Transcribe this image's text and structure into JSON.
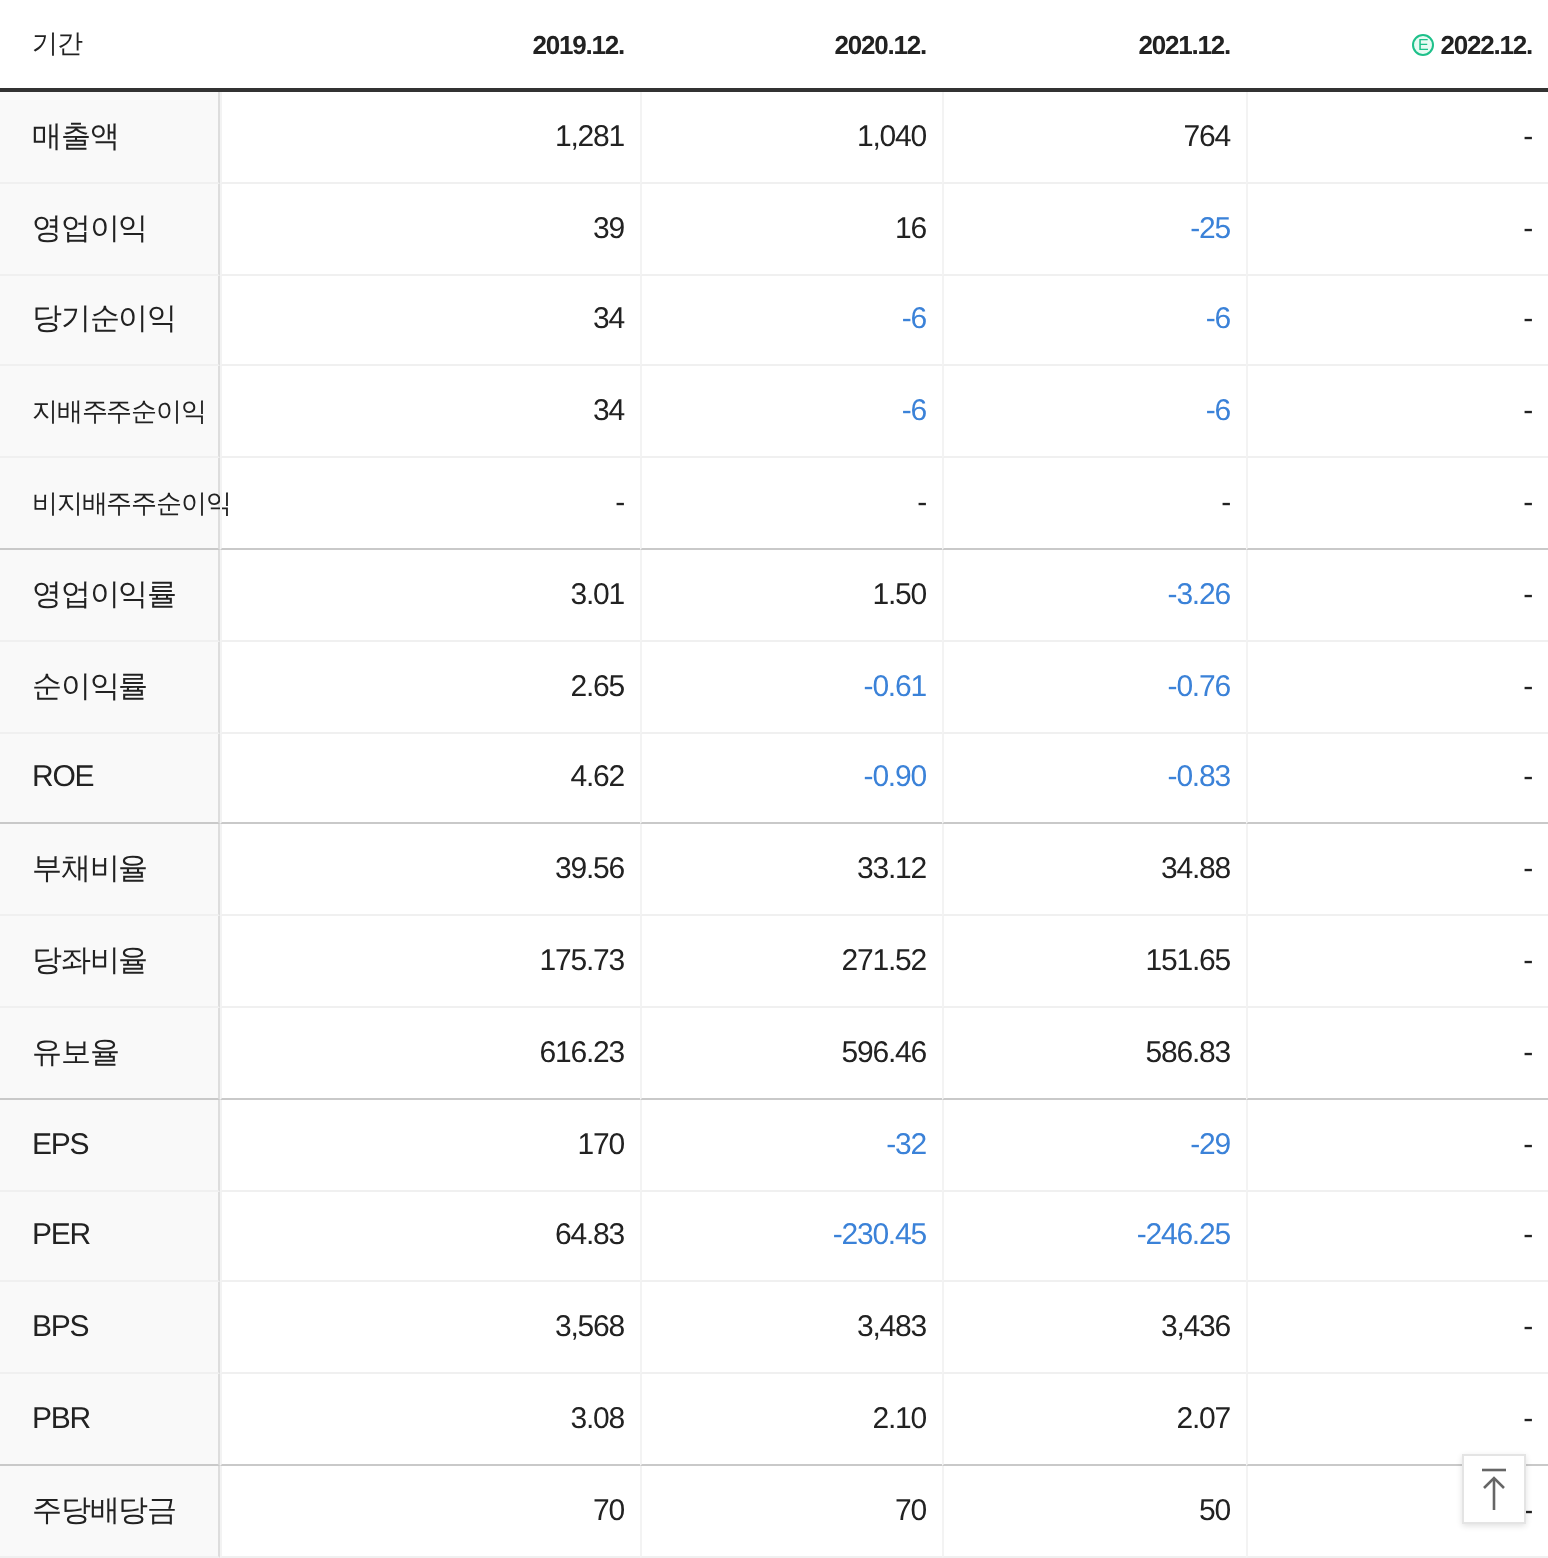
{
  "table": {
    "label_header": "기간",
    "columns": [
      {
        "label": "2019.12.",
        "estimate": false
      },
      {
        "label": "2020.12.",
        "estimate": false
      },
      {
        "label": "2021.12.",
        "estimate": false
      },
      {
        "label": "2022.12.",
        "estimate": true,
        "badge": "E"
      }
    ],
    "rows": [
      {
        "label": "매출액",
        "kind": "main",
        "section_end": false,
        "cells": [
          {
            "text": "1,281",
            "negative": false
          },
          {
            "text": "1,040",
            "negative": false
          },
          {
            "text": "764",
            "negative": false
          },
          {
            "text": "-",
            "negative": false
          }
        ]
      },
      {
        "label": "영업이익",
        "kind": "main",
        "section_end": false,
        "cells": [
          {
            "text": "39",
            "negative": false
          },
          {
            "text": "16",
            "negative": false
          },
          {
            "text": "-25",
            "negative": true
          },
          {
            "text": "-",
            "negative": false
          }
        ]
      },
      {
        "label": "당기순이익",
        "kind": "main",
        "section_end": false,
        "cells": [
          {
            "text": "34",
            "negative": false
          },
          {
            "text": "-6",
            "negative": true
          },
          {
            "text": "-6",
            "negative": true
          },
          {
            "text": "-",
            "negative": false
          }
        ]
      },
      {
        "label": "지배주주순이익",
        "kind": "sub",
        "section_end": false,
        "cells": [
          {
            "text": "34",
            "negative": false
          },
          {
            "text": "-6",
            "negative": true
          },
          {
            "text": "-6",
            "negative": true
          },
          {
            "text": "-",
            "negative": false
          }
        ]
      },
      {
        "label": "비지배주주순이익",
        "kind": "sub",
        "section_end": true,
        "cells": [
          {
            "text": "-",
            "negative": false
          },
          {
            "text": "-",
            "negative": false
          },
          {
            "text": "-",
            "negative": false
          },
          {
            "text": "-",
            "negative": false
          }
        ]
      },
      {
        "label": "영업이익률",
        "kind": "main",
        "section_end": false,
        "cells": [
          {
            "text": "3.01",
            "negative": false
          },
          {
            "text": "1.50",
            "negative": false
          },
          {
            "text": "-3.26",
            "negative": true
          },
          {
            "text": "-",
            "negative": false
          }
        ]
      },
      {
        "label": "순이익률",
        "kind": "main",
        "section_end": false,
        "cells": [
          {
            "text": "2.65",
            "negative": false
          },
          {
            "text": "-0.61",
            "negative": true
          },
          {
            "text": "-0.76",
            "negative": true
          },
          {
            "text": "-",
            "negative": false
          }
        ]
      },
      {
        "label": "ROE",
        "kind": "main",
        "section_end": true,
        "cells": [
          {
            "text": "4.62",
            "negative": false
          },
          {
            "text": "-0.90",
            "negative": true
          },
          {
            "text": "-0.83",
            "negative": true
          },
          {
            "text": "-",
            "negative": false
          }
        ]
      },
      {
        "label": "부채비율",
        "kind": "main",
        "section_end": false,
        "cells": [
          {
            "text": "39.56",
            "negative": false
          },
          {
            "text": "33.12",
            "negative": false
          },
          {
            "text": "34.88",
            "negative": false
          },
          {
            "text": "-",
            "negative": false
          }
        ]
      },
      {
        "label": "당좌비율",
        "kind": "main",
        "section_end": false,
        "cells": [
          {
            "text": "175.73",
            "negative": false
          },
          {
            "text": "271.52",
            "negative": false
          },
          {
            "text": "151.65",
            "negative": false
          },
          {
            "text": "-",
            "negative": false
          }
        ]
      },
      {
        "label": "유보율",
        "kind": "main",
        "section_end": true,
        "cells": [
          {
            "text": "616.23",
            "negative": false
          },
          {
            "text": "596.46",
            "negative": false
          },
          {
            "text": "586.83",
            "negative": false
          },
          {
            "text": "-",
            "negative": false
          }
        ]
      },
      {
        "label": "EPS",
        "kind": "main",
        "section_end": false,
        "cells": [
          {
            "text": "170",
            "negative": false
          },
          {
            "text": "-32",
            "negative": true
          },
          {
            "text": "-29",
            "negative": true
          },
          {
            "text": "-",
            "negative": false
          }
        ]
      },
      {
        "label": "PER",
        "kind": "main",
        "section_end": false,
        "cells": [
          {
            "text": "64.83",
            "negative": false
          },
          {
            "text": "-230.45",
            "negative": true
          },
          {
            "text": "-246.25",
            "negative": true
          },
          {
            "text": "-",
            "negative": false
          }
        ]
      },
      {
        "label": "BPS",
        "kind": "main",
        "section_end": false,
        "cells": [
          {
            "text": "3,568",
            "negative": false
          },
          {
            "text": "3,483",
            "negative": false
          },
          {
            "text": "3,436",
            "negative": false
          },
          {
            "text": "-",
            "negative": false
          }
        ]
      },
      {
        "label": "PBR",
        "kind": "main",
        "section_end": true,
        "cells": [
          {
            "text": "3.08",
            "negative": false
          },
          {
            "text": "2.10",
            "negative": false
          },
          {
            "text": "2.07",
            "negative": false
          },
          {
            "text": "-",
            "negative": false
          }
        ]
      },
      {
        "label": "주당배당금",
        "kind": "main",
        "section_end": false,
        "cells": [
          {
            "text": "70",
            "negative": false
          },
          {
            "text": "70",
            "negative": false
          },
          {
            "text": "50",
            "negative": false
          },
          {
            "text": "-",
            "negative": false
          }
        ]
      }
    ]
  }
}
